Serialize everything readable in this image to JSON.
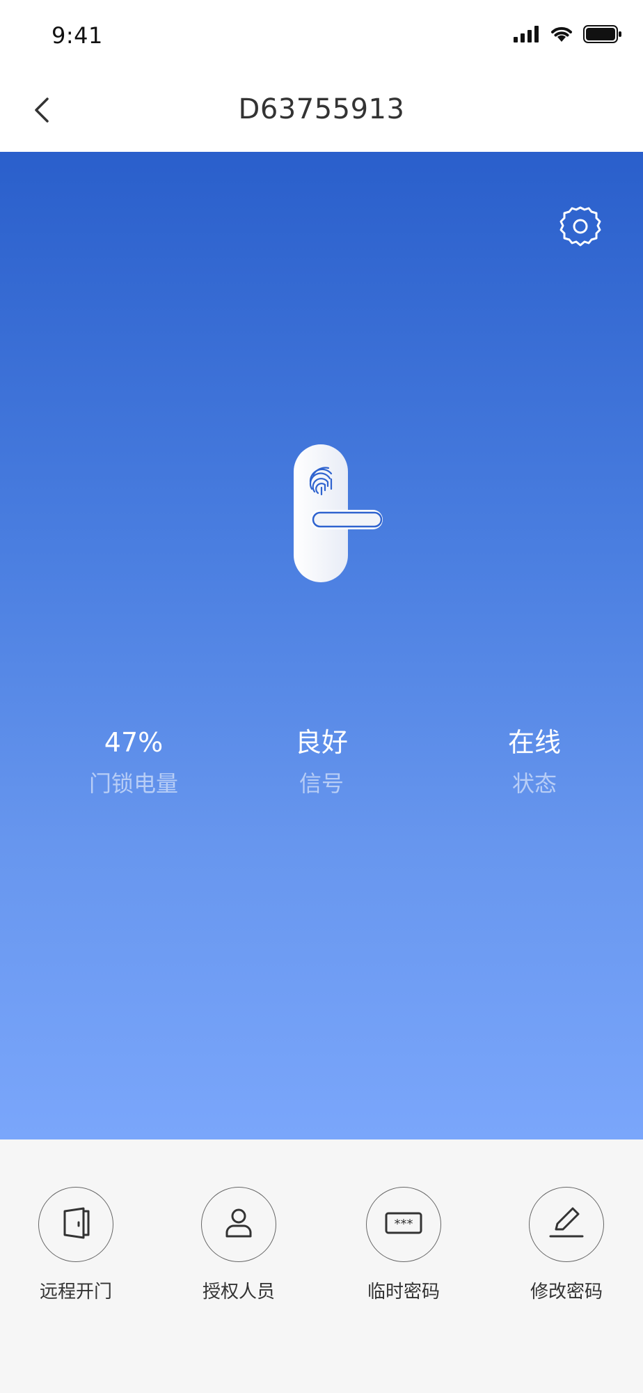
{
  "status_bar": {
    "time": "9:41",
    "icons": [
      "signal-icon",
      "wifi-icon",
      "battery-icon"
    ]
  },
  "header": {
    "title": "D63755913",
    "back_icon": "chevron-left-icon"
  },
  "hero": {
    "settings_icon": "gear-icon",
    "illustration": "smart-lock-fingerprint-icon",
    "gradient_top": "#2a5fcb",
    "gradient_bottom": "#7aa6fb"
  },
  "stats": [
    {
      "value": "47%",
      "label": "门锁电量"
    },
    {
      "value": "良好",
      "label": "信号"
    },
    {
      "value": "在线",
      "label": "状态"
    }
  ],
  "actions": [
    {
      "label": "远程开门",
      "icon": "door-icon"
    },
    {
      "label": "授权人员",
      "icon": "user-icon"
    },
    {
      "label": "临时密码",
      "icon": "password-icon"
    },
    {
      "label": "修改密码",
      "icon": "edit-icon"
    }
  ]
}
